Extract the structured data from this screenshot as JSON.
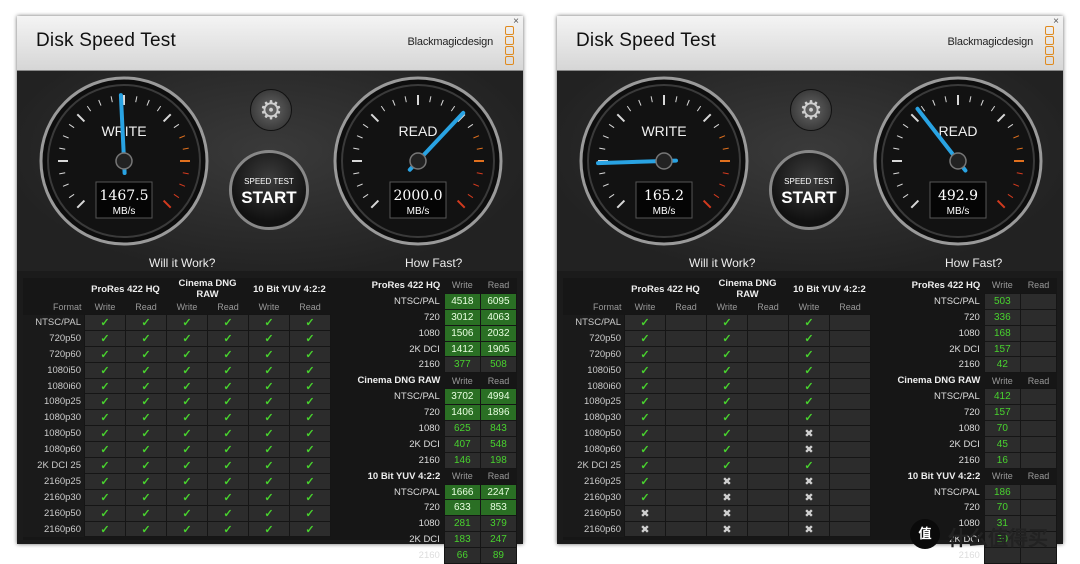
{
  "colors": {
    "accent": "#29a3e3",
    "ok": "#48d22e",
    "brand_orange": "#e08a1e"
  },
  "windows": [
    {
      "title": "Disk Speed Test",
      "brand": "Blackmagicdesign",
      "close_label": "×",
      "write": {
        "label": "WRITE",
        "value": "1467.5",
        "unit": "MB/s",
        "needle_fraction": 0.49
      },
      "read": {
        "label": "READ",
        "value": "2000.0",
        "unit": "MB/s",
        "needle_fraction": 0.66
      },
      "start": {
        "small": "SPEED TEST",
        "big": "START"
      },
      "will_it_work": {
        "title": "Will it Work?",
        "groups": [
          "ProRes 422 HQ",
          "Cinema DNG RAW",
          "10 Bit YUV 4:2:2"
        ],
        "format_label": "Format",
        "write_label": "Write",
        "read_label": "Read",
        "rows": [
          {
            "format": "NTSC/PAL",
            "cells": [
              "✓",
              "✓",
              "✓",
              "✓",
              "✓",
              "✓"
            ]
          },
          {
            "format": "720p50",
            "cells": [
              "✓",
              "✓",
              "✓",
              "✓",
              "✓",
              "✓"
            ]
          },
          {
            "format": "720p60",
            "cells": [
              "✓",
              "✓",
              "✓",
              "✓",
              "✓",
              "✓"
            ]
          },
          {
            "format": "1080i50",
            "cells": [
              "✓",
              "✓",
              "✓",
              "✓",
              "✓",
              "✓"
            ]
          },
          {
            "format": "1080i60",
            "cells": [
              "✓",
              "✓",
              "✓",
              "✓",
              "✓",
              "✓"
            ]
          },
          {
            "format": "1080p25",
            "cells": [
              "✓",
              "✓",
              "✓",
              "✓",
              "✓",
              "✓"
            ]
          },
          {
            "format": "1080p30",
            "cells": [
              "✓",
              "✓",
              "✓",
              "✓",
              "✓",
              "✓"
            ]
          },
          {
            "format": "1080p50",
            "cells": [
              "✓",
              "✓",
              "✓",
              "✓",
              "✓",
              "✓"
            ]
          },
          {
            "format": "1080p60",
            "cells": [
              "✓",
              "✓",
              "✓",
              "✓",
              "✓",
              "✓"
            ]
          },
          {
            "format": "2K DCI 25",
            "cells": [
              "✓",
              "✓",
              "✓",
              "✓",
              "✓",
              "✓"
            ]
          },
          {
            "format": "2160p25",
            "cells": [
              "✓",
              "✓",
              "✓",
              "✓",
              "✓",
              "✓"
            ]
          },
          {
            "format": "2160p30",
            "cells": [
              "✓",
              "✓",
              "✓",
              "✓",
              "✓",
              "✓"
            ]
          },
          {
            "format": "2160p50",
            "cells": [
              "✓",
              "✓",
              "✓",
              "✓",
              "✓",
              "✓"
            ]
          },
          {
            "format": "2160p60",
            "cells": [
              "✓",
              "✓",
              "✓",
              "✓",
              "✓",
              "✓"
            ]
          }
        ]
      },
      "how_fast": {
        "title": "How Fast?",
        "sections": [
          {
            "name": "ProRes 422 HQ",
            "write_label": "Write",
            "read_label": "Read",
            "rows": [
              {
                "label": "NTSC/PAL",
                "write": "4518",
                "read": "6095"
              },
              {
                "label": "720",
                "write": "3012",
                "read": "4063"
              },
              {
                "label": "1080",
                "write": "1506",
                "read": "2032"
              },
              {
                "label": "2K DCI",
                "write": "1412",
                "read": "1905"
              },
              {
                "label": "2160",
                "write": "377",
                "read": "508"
              }
            ]
          },
          {
            "name": "Cinema DNG RAW",
            "write_label": "Write",
            "read_label": "Read",
            "rows": [
              {
                "label": "NTSC/PAL",
                "write": "3702",
                "read": "4994"
              },
              {
                "label": "720",
                "write": "1406",
                "read": "1896"
              },
              {
                "label": "1080",
                "write": "625",
                "read": "843"
              },
              {
                "label": "2K DCI",
                "write": "407",
                "read": "548"
              },
              {
                "label": "2160",
                "write": "146",
                "read": "198"
              }
            ]
          },
          {
            "name": "10 Bit YUV 4:2:2",
            "write_label": "Write",
            "read_label": "Read",
            "rows": [
              {
                "label": "NTSC/PAL",
                "write": "1666",
                "read": "2247"
              },
              {
                "label": "720",
                "write": "633",
                "read": "853"
              },
              {
                "label": "1080",
                "write": "281",
                "read": "379"
              },
              {
                "label": "2K DCI",
                "write": "183",
                "read": "247"
              },
              {
                "label": "2160",
                "write": "66",
                "read": "89"
              }
            ]
          }
        ]
      }
    },
    {
      "title": "Disk Speed Test",
      "brand": "Blackmagicdesign",
      "close_label": "×",
      "write": {
        "label": "WRITE",
        "value": "165.2",
        "unit": "MB/s",
        "needle_fraction": 0.16
      },
      "read": {
        "label": "READ",
        "value": "492.9",
        "unit": "MB/s",
        "needle_fraction": 0.36
      },
      "start": {
        "small": "SPEED TEST",
        "big": "START"
      },
      "will_it_work": {
        "title": "Will it Work?",
        "groups": [
          "ProRes 422 HQ",
          "Cinema DNG RAW",
          "10 Bit YUV 4:2:2"
        ],
        "format_label": "Format",
        "write_label": "Write",
        "read_label": "Read",
        "rows": [
          {
            "format": "NTSC/PAL",
            "cells": [
              "✓",
              "",
              "✓",
              "",
              "✓",
              ""
            ]
          },
          {
            "format": "720p50",
            "cells": [
              "✓",
              "",
              "✓",
              "",
              "✓",
              ""
            ]
          },
          {
            "format": "720p60",
            "cells": [
              "✓",
              "",
              "✓",
              "",
              "✓",
              ""
            ]
          },
          {
            "format": "1080i50",
            "cells": [
              "✓",
              "",
              "✓",
              "",
              "✓",
              ""
            ]
          },
          {
            "format": "1080i60",
            "cells": [
              "✓",
              "",
              "✓",
              "",
              "✓",
              ""
            ]
          },
          {
            "format": "1080p25",
            "cells": [
              "✓",
              "",
              "✓",
              "",
              "✓",
              ""
            ]
          },
          {
            "format": "1080p30",
            "cells": [
              "✓",
              "",
              "✓",
              "",
              "✓",
              ""
            ]
          },
          {
            "format": "1080p50",
            "cells": [
              "✓",
              "",
              "✓",
              "",
              "✖",
              ""
            ]
          },
          {
            "format": "1080p60",
            "cells": [
              "✓",
              "",
              "✓",
              "",
              "✖",
              ""
            ]
          },
          {
            "format": "2K DCI 25",
            "cells": [
              "✓",
              "",
              "✓",
              "",
              "✓",
              ""
            ]
          },
          {
            "format": "2160p25",
            "cells": [
              "✓",
              "",
              "✖",
              "",
              "✖",
              ""
            ]
          },
          {
            "format": "2160p30",
            "cells": [
              "✓",
              "",
              "✖",
              "",
              "✖",
              ""
            ]
          },
          {
            "format": "2160p50",
            "cells": [
              "✖",
              "",
              "✖",
              "",
              "✖",
              ""
            ]
          },
          {
            "format": "2160p60",
            "cells": [
              "✖",
              "",
              "✖",
              "",
              "✖",
              ""
            ]
          }
        ]
      },
      "how_fast": {
        "title": "How Fast?",
        "sections": [
          {
            "name": "ProRes 422 HQ",
            "write_label": "Write",
            "read_label": "Read",
            "rows": [
              {
                "label": "NTSC/PAL",
                "write": "503",
                "read": ""
              },
              {
                "label": "720",
                "write": "336",
                "read": ""
              },
              {
                "label": "1080",
                "write": "168",
                "read": ""
              },
              {
                "label": "2K DCI",
                "write": "157",
                "read": ""
              },
              {
                "label": "2160",
                "write": "42",
                "read": ""
              }
            ]
          },
          {
            "name": "Cinema DNG RAW",
            "write_label": "Write",
            "read_label": "Read",
            "rows": [
              {
                "label": "NTSC/PAL",
                "write": "412",
                "read": ""
              },
              {
                "label": "720",
                "write": "157",
                "read": ""
              },
              {
                "label": "1080",
                "write": "70",
                "read": ""
              },
              {
                "label": "2K DCI",
                "write": "45",
                "read": ""
              },
              {
                "label": "2160",
                "write": "16",
                "read": ""
              }
            ]
          },
          {
            "name": "10 Bit YUV 4:2:2",
            "write_label": "Write",
            "read_label": "Read",
            "rows": [
              {
                "label": "NTSC/PAL",
                "write": "186",
                "read": ""
              },
              {
                "label": "720",
                "write": "70",
                "read": ""
              },
              {
                "label": "1080",
                "write": "31",
                "read": ""
              },
              {
                "label": "2K DCI",
                "write": "20",
                "read": ""
              },
              {
                "label": "2160",
                "write": "",
                "read": ""
              }
            ]
          }
        ]
      }
    }
  ],
  "watermark": {
    "badge": "值",
    "text": "什么值得买"
  }
}
